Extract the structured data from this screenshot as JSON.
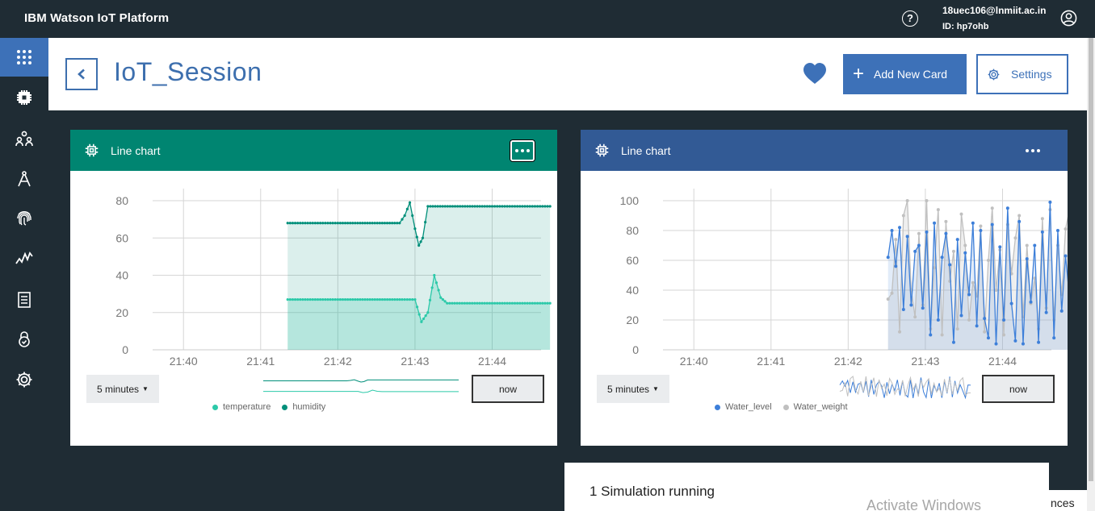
{
  "app": {
    "title": "IBM Watson IoT Platform"
  },
  "user": {
    "email": "18uec106@lnmiit.ac.in",
    "id_label": "ID:",
    "id_value": "hp7ohb"
  },
  "sidebar": {
    "items": [
      {
        "name": "apps-grid",
        "icon": "grid-icon",
        "active": true
      },
      {
        "name": "devices",
        "icon": "chip-icon"
      },
      {
        "name": "members",
        "icon": "members-icon"
      },
      {
        "name": "apps",
        "icon": "compass-icon"
      },
      {
        "name": "security",
        "icon": "fingerprint-icon"
      },
      {
        "name": "usage",
        "icon": "activity-icon"
      },
      {
        "name": "logs",
        "icon": "document-icon"
      },
      {
        "name": "access",
        "icon": "lock-icon"
      },
      {
        "name": "settings",
        "icon": "gear-icon"
      }
    ]
  },
  "header": {
    "title": "IoT_Session",
    "add_card_label": "Add New Card",
    "settings_label": "Settings"
  },
  "cards": [
    {
      "title": "Line chart",
      "header_color": "#008571",
      "range_label": "5 minutes",
      "now_label": "now",
      "chart_data": {
        "type": "area",
        "x_ticks": [
          "21:40",
          "21:41",
          "21:42",
          "21:43",
          "21:44"
        ],
        "ylim": [
          0,
          80
        ],
        "y_ticks": [
          0,
          20,
          40,
          60,
          80
        ],
        "series": [
          {
            "name": "temperature",
            "color": "#2cc9a9",
            "x": [
              "21:41:21",
              "21:42:00",
              "21:42:50",
              "21:43:00",
              "21:43:05",
              "21:43:10",
              "21:43:15",
              "21:43:20",
              "21:43:25",
              "21:44:00",
              "21:44:45"
            ],
            "values": [
              27,
              27,
              27,
              27,
              15,
              20,
              40,
              28,
              25,
              25,
              25
            ]
          },
          {
            "name": "humidity",
            "color": "#008f7a",
            "x": [
              "21:41:21",
              "21:42:00",
              "21:42:48",
              "21:42:52",
              "21:42:56",
              "21:43:00",
              "21:43:03",
              "21:43:06",
              "21:43:10",
              "21:44:00",
              "21:44:45"
            ],
            "values": [
              68,
              68,
              68,
              72,
              79,
              65,
              56,
              60,
              77,
              77,
              77
            ]
          }
        ]
      }
    },
    {
      "title": "Line chart",
      "header_color": "#325a95",
      "range_label": "5 minutes",
      "now_label": "now",
      "chart_data": {
        "type": "area",
        "x_ticks": [
          "21:40",
          "21:41",
          "21:42",
          "21:43",
          "21:44"
        ],
        "ylim": [
          0,
          100
        ],
        "y_ticks": [
          0,
          20,
          40,
          60,
          80,
          100
        ],
        "x_start": "21:42:31",
        "x_step_seconds": 3,
        "series": [
          {
            "name": "Water_level",
            "color": "#3d7fd9",
            "values": [
              62,
              80,
              56,
              82,
              27,
              76,
              30,
              66,
              70,
              28,
              79,
              10,
              85,
              20,
              62,
              78,
              57,
              5,
              74,
              23,
              65,
              37,
              85,
              16,
              80,
              21,
              8,
              84,
              4,
              69,
              20,
              95,
              31,
              6,
              86,
              4,
              61,
              32,
              70,
              5,
              79,
              25,
              99,
              8,
              80,
              26,
              63,
              36,
              5,
              62,
              61
            ]
          },
          {
            "name": "Water_weight",
            "color": "#c0c0c0",
            "values": [
              34,
              38,
              74,
              12,
              90,
              100,
              40,
              22,
              78,
              30,
              100,
              14,
              55,
              94,
              10,
              86,
              46,
              66,
              14,
              91,
              70,
              20,
              45,
              36,
              83,
              12,
              60,
              95,
              40,
              67,
              10,
              84,
              51,
              75,
              90,
              22,
              70,
              31,
              48,
              14,
              88,
              28,
              94,
              20,
              70,
              37,
              81,
              94,
              17,
              27,
              27
            ]
          }
        ]
      }
    }
  ],
  "simulation": {
    "text": "1 Simulation running"
  },
  "overlay": {
    "activate_text": "Activate Windows",
    "partial_text": "nces"
  }
}
